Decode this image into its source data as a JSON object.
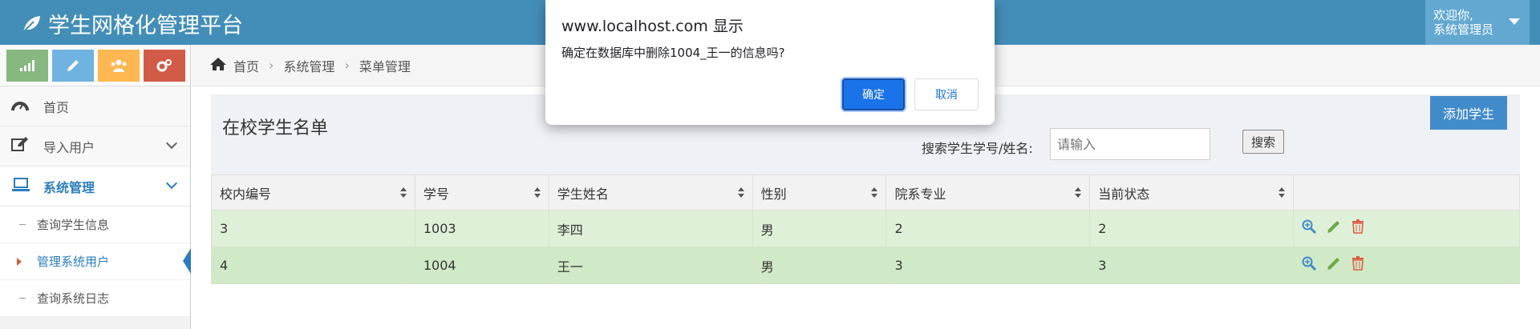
{
  "header": {
    "brand": "学生网格化管理平台",
    "welcome": "欢迎你,",
    "user": "系统管理员"
  },
  "shortcuts": [
    {
      "icon": "signal-icon",
      "color": "#87b87f"
    },
    {
      "icon": "pencil-icon",
      "color": "#6fb3e0"
    },
    {
      "icon": "users-icon",
      "color": "#ffb752"
    },
    {
      "icon": "cogs-icon",
      "color": "#d15b47"
    }
  ],
  "sidebar": {
    "home": "首页",
    "import_users": "导入用户",
    "system_mgmt": "系统管理",
    "sub_items": [
      "查询学生信息",
      "管理系统用户",
      "查询系统日志"
    ]
  },
  "breadcrumb": [
    "首页",
    "系统管理",
    "菜单管理"
  ],
  "panel": {
    "title": "在校学生名单",
    "add_button": "添加学生",
    "search_label": "搜索学生学号/姓名:",
    "search_placeholder": "请输入",
    "search_button": "搜索"
  },
  "table": {
    "columns": [
      "校内编号",
      "学号",
      "学生姓名",
      "性别",
      "院系专业",
      "当前状态"
    ],
    "rows": [
      [
        "3",
        "1003",
        "李四",
        "男",
        "2",
        "2"
      ],
      [
        "4",
        "1004",
        "王一",
        "男",
        "3",
        "3"
      ]
    ]
  },
  "dialog": {
    "title": "www.localhost.com 显示",
    "message": "确定在数据库中删除1004_王一的信息吗?",
    "ok": "确定",
    "cancel": "取消"
  }
}
